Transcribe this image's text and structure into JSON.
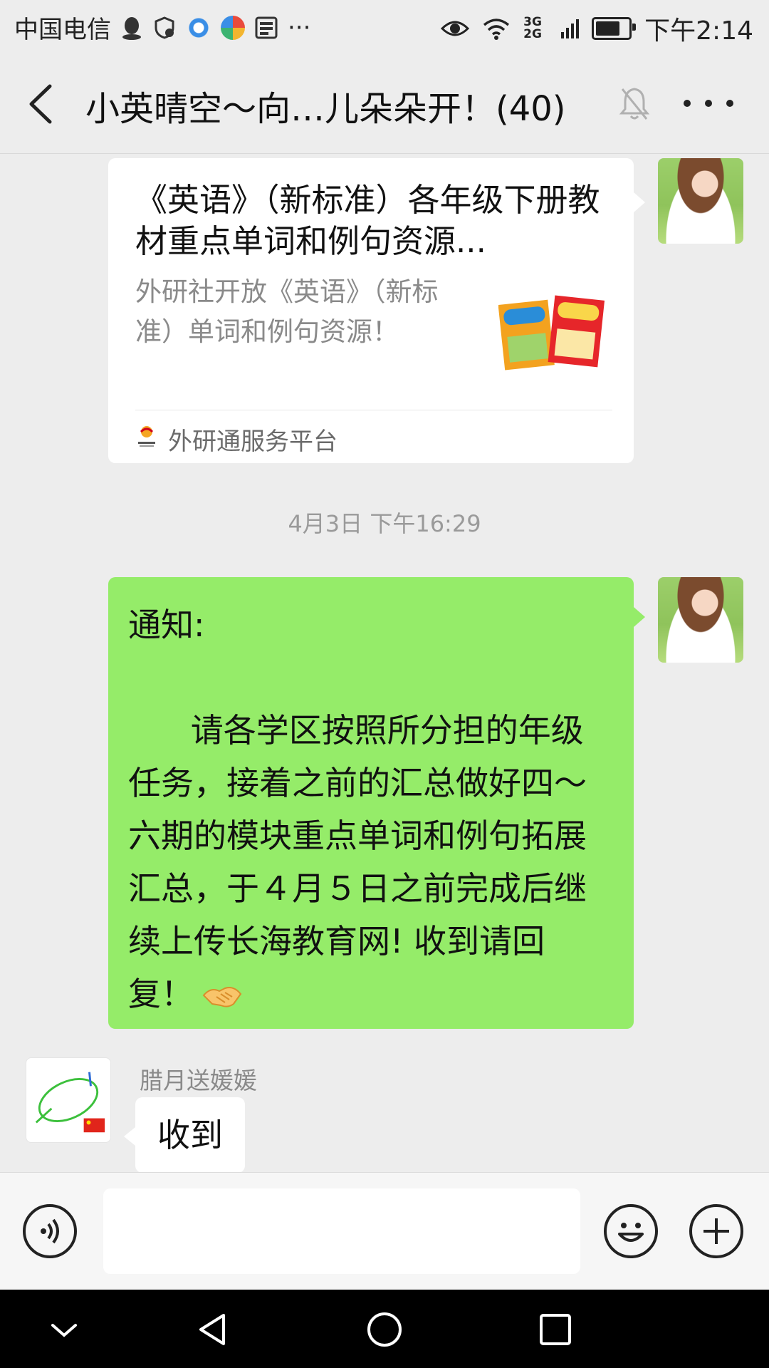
{
  "status_bar": {
    "carrier": "中国电信",
    "more": "···",
    "network": "3G 2G",
    "time": "下午2:14"
  },
  "header": {
    "back_icon": "back-arrow-icon",
    "title": "小英晴空～向…儿朵朵开！(40)",
    "mute_icon": "bell-muted-icon",
    "more_icon": "more-dots-icon"
  },
  "messages": {
    "link_card": {
      "title": "《英语》（新标准）各年级下册教材重点单词和例句资源...",
      "description": "外研社开放《英语》（新标准）单词和例句资源！",
      "source": "外研通服务平台"
    },
    "timestamp": "4月3日 下午16:29",
    "notice": {
      "lines": [
        "通知:",
        "",
        "      请各学区按照所分担的年级",
        "任务，接着之前的汇总做好四～",
        "六期的模块重点单词和例句拓展",
        "汇总，于４月５日之前完成后继",
        "续上传长海教育网! 收到请回",
        "复！"
      ]
    },
    "reply": {
      "sender": "腊月送媛媛",
      "text": "收到"
    }
  },
  "input_bar": {
    "voice_icon": "voice-icon",
    "text_value": "",
    "emoji_icon": "emoji-icon",
    "plus_icon": "plus-icon"
  },
  "nav_bar": {
    "icons": [
      "collapse-icon",
      "back-triangle-icon",
      "home-circle-icon",
      "recents-square-icon"
    ]
  },
  "colors": {
    "background": "#ededed",
    "my_bubble": "#95ec69",
    "other_bubble": "#ffffff",
    "timestamp": "#9a9a9a"
  }
}
